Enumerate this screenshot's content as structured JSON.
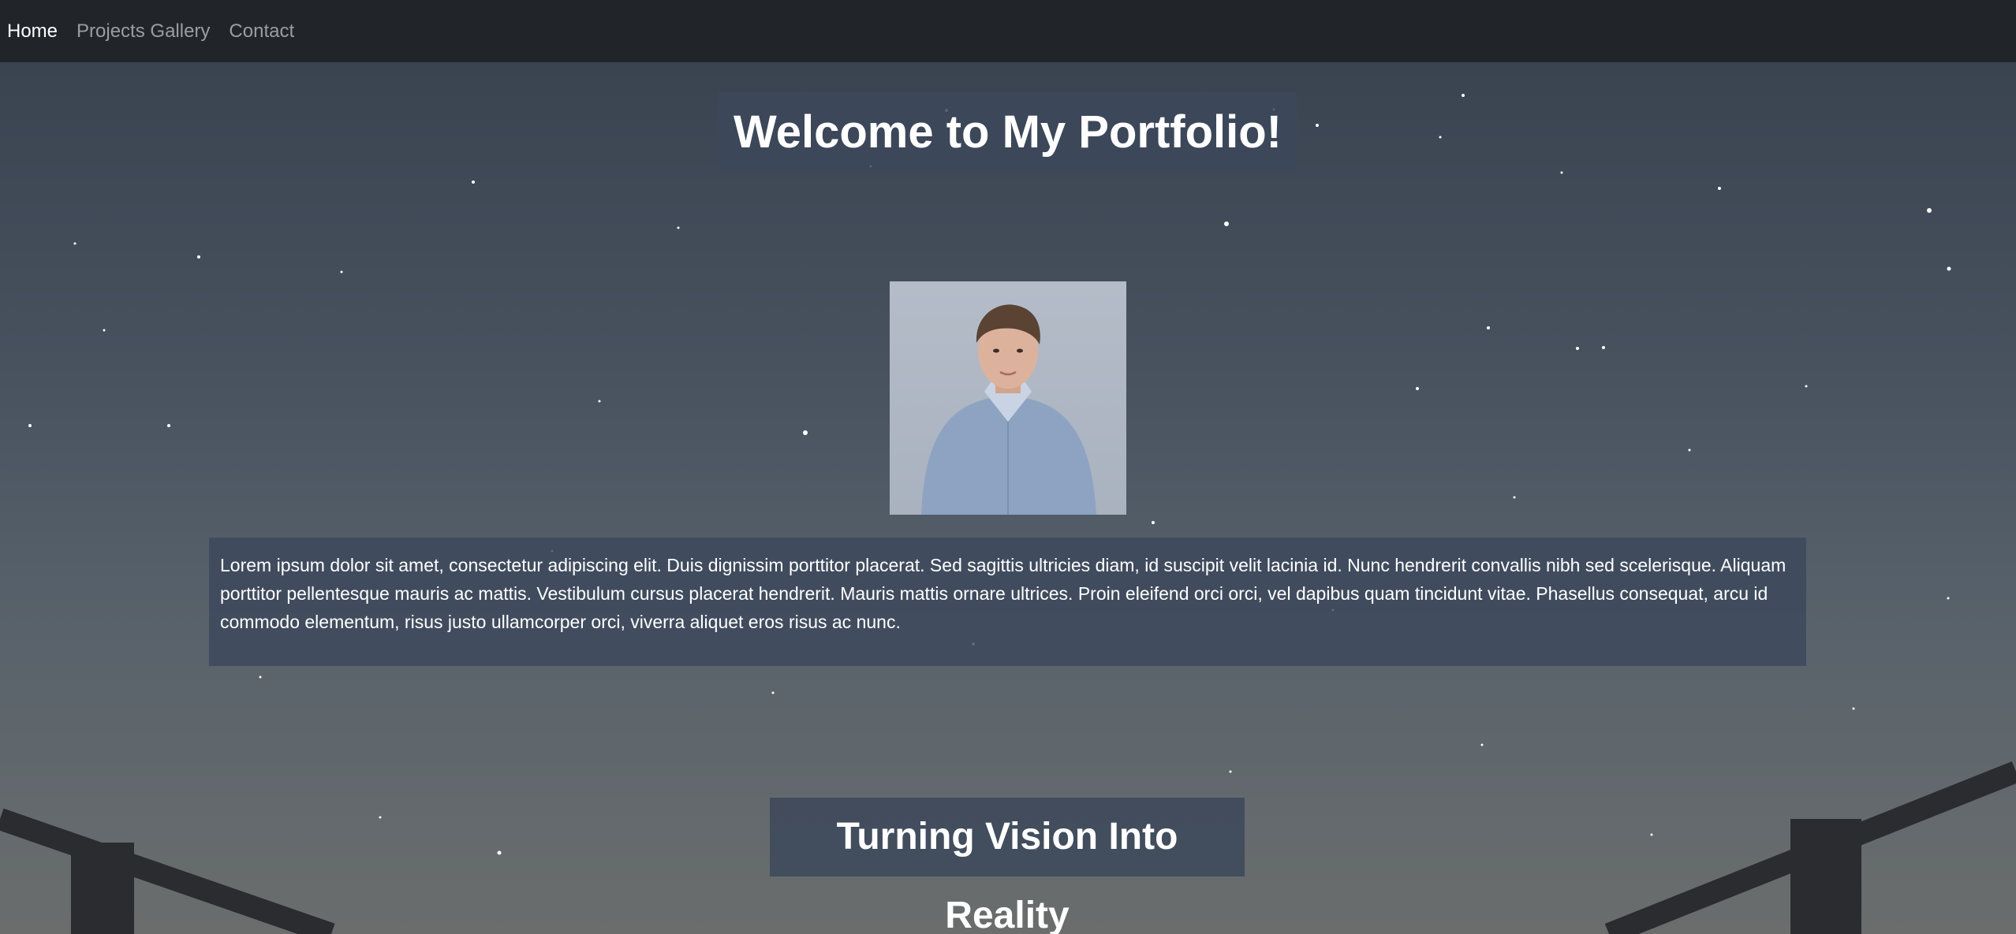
{
  "nav": {
    "items": [
      {
        "label": "Home"
      },
      {
        "label": "Projects Gallery"
      },
      {
        "label": "Contact"
      }
    ]
  },
  "hero": {
    "title": "Welcome to My Portfolio!"
  },
  "about": {
    "text": "Lorem ipsum dolor sit amet, consectetur adipiscing elit. Duis dignissim porttitor placerat. Sed sagittis ultricies diam, id suscipit velit lacinia id. Nunc hendrerit convallis nibh sed scelerisque. Aliquam porttitor pellentesque mauris ac mattis. Vestibulum cursus placerat hendrerit. Mauris mattis ornare ultrices. Proin eleifend orci orci, vel dapibus quam tincidunt vitae. Phasellus consequat, arcu id commodo elementum, risus justo ullamcorper orci, viverra aliquet eros risus ac nunc."
  },
  "section": {
    "title": "Turning Vision Into Reality"
  },
  "colors": {
    "navbar": "#212529",
    "nav_active": "#ffffff",
    "nav_inactive": "#8c8f93",
    "panel": "#3c485a"
  }
}
